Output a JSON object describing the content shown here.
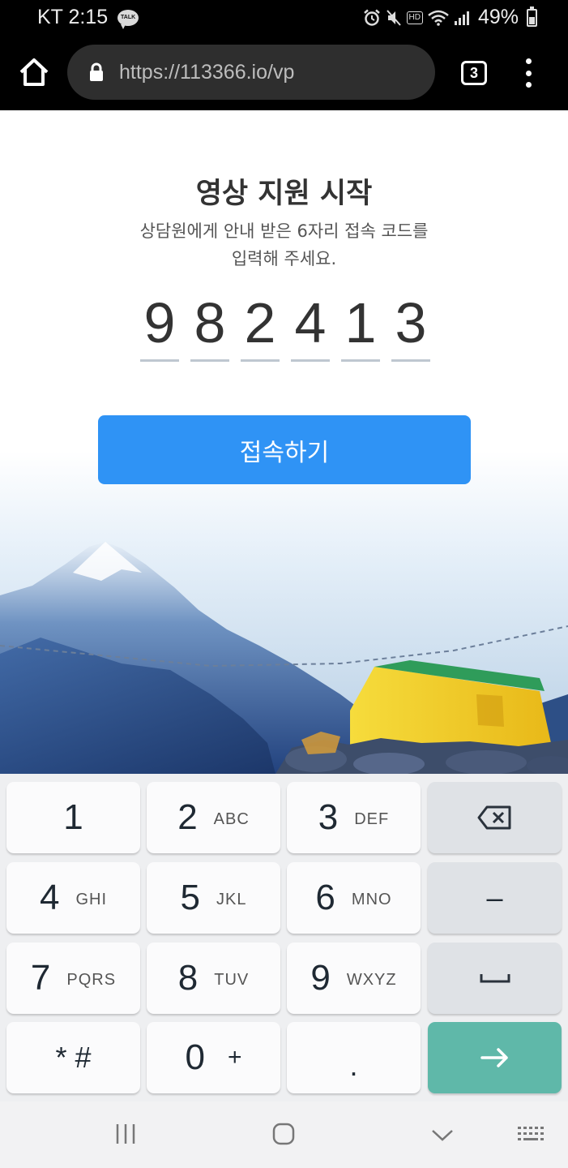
{
  "status_bar": {
    "carrier_time": "KT 2:15",
    "talk_badge": "TALK",
    "hd_badge": "HD",
    "battery": "49%",
    "battery_level": 0.49,
    "icons": [
      "kakaotalk-notification-icon",
      "alarm-icon",
      "mute-icon",
      "hd-voice-icon",
      "wifi-icon",
      "signal-icon",
      "battery-icon"
    ]
  },
  "browser": {
    "url": "https://113366.io/vp",
    "tab_count": "3",
    "icons": [
      "home-icon",
      "lock-icon",
      "tabs-icon",
      "more-icon"
    ]
  },
  "main": {
    "title": "영상 지원 시작",
    "subtitle_line1": "상담원에게 안내 받은 6자리 접속 코드를",
    "subtitle_line2": "입력해 주세요.",
    "code_digits": [
      "9",
      "8",
      "2",
      "4",
      "1",
      "3"
    ],
    "connect_button": "접속하기",
    "accent_color": "#2f93f5"
  },
  "keypad": {
    "keys": [
      {
        "num": "1",
        "letters": ""
      },
      {
        "num": "2",
        "letters": "ABC"
      },
      {
        "num": "3",
        "letters": "DEF"
      },
      {
        "num": "4",
        "letters": "GHI"
      },
      {
        "num": "5",
        "letters": "JKL"
      },
      {
        "num": "6",
        "letters": "MNO"
      },
      {
        "num": "7",
        "letters": "PQRS"
      },
      {
        "num": "8",
        "letters": "TUV"
      },
      {
        "num": "9",
        "letters": "WXYZ"
      },
      {
        "num": "*",
        "letters": "#"
      },
      {
        "num": "0",
        "letters": "+"
      },
      {
        "num": ".",
        "letters": ""
      }
    ],
    "minus": "–",
    "function_icons": [
      "backspace-icon",
      "space-icon",
      "enter-arrow-icon"
    ],
    "go_color": "#5fb8a9"
  },
  "nav_bar": {
    "icons": [
      "recent-apps-icon",
      "home-circle-icon",
      "back-chevron-icon",
      "keyboard-icon"
    ]
  }
}
